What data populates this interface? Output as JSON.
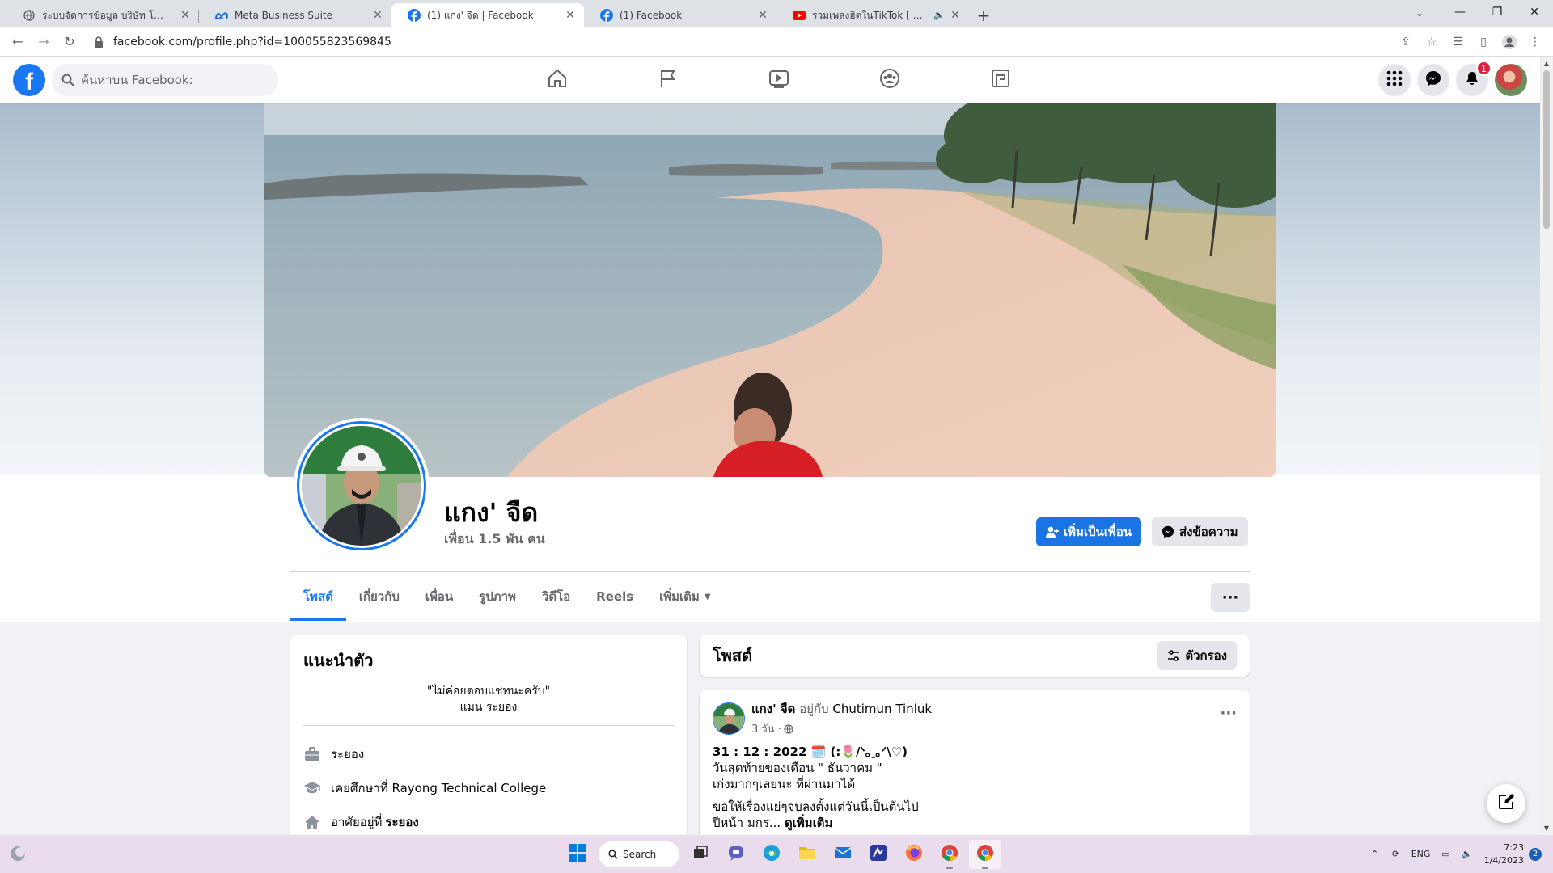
{
  "browser": {
    "tabs": [
      {
        "title": "ระบบจัดการข้อมูล บริษัท โชคลูกโชค",
        "icon": "globe-icon"
      },
      {
        "title": "Meta Business Suite",
        "icon": "meta-icon"
      },
      {
        "title": "(1) แกง' จืด | Facebook",
        "icon": "facebook-icon",
        "active": true
      },
      {
        "title": "(1) Facebook",
        "icon": "facebook-icon"
      },
      {
        "title": "รวมเพลงฮิตในTikTok [ มีเพิ่มใหม่ทุก",
        "icon": "youtube-icon"
      }
    ],
    "url": "facebook.com/profile.php?id=100055823569845"
  },
  "fb_header": {
    "logo": "f",
    "search_placeholder": "ค้นหาบน Facebook:",
    "nav": [
      "home-icon",
      "pages-flag-icon",
      "watch-video-icon",
      "groups-icon",
      "gaming-icon"
    ],
    "notifications_count": "1"
  },
  "profile": {
    "name": "แกง' จืด",
    "friends": "เพื่อน 1.5 พัน คน",
    "add_friend_label": "เพิ่มเป็นเพื่อน",
    "message_label": "ส่งข้อความ",
    "tabs": [
      "โพสต์",
      "เกี่ยวกับ",
      "เพื่อน",
      "รูปภาพ",
      "วิดีโอ",
      "Reels",
      "เพิ่มเติม"
    ],
    "more_dots": "···"
  },
  "intro": {
    "title": "แนะนำตัว",
    "bio_line1": "\"ไม่ค่อยตอบแชทนะครับ\"",
    "bio_line2": "แมน ระยอง",
    "rows": [
      {
        "icon": "work-icon",
        "text": "ระยอง",
        "bold": ""
      },
      {
        "icon": "education-icon",
        "text": "เคยศึกษาที่ Rayong Technical College",
        "bold": ""
      },
      {
        "icon": "home-location-icon",
        "text": "อาศัยอยู่ที่",
        "bold": "ระยอง"
      }
    ]
  },
  "posts": {
    "title": "โพสต์",
    "filter_label": "ตัวกรอง"
  },
  "post": {
    "author": "แกง' จืด",
    "with_text": "อยู่กับ",
    "tagged": "Chutimun Tinluk",
    "time": "3 วัน ·",
    "dots": "···",
    "line1": "31 : 12 : 2022 🗓️ (:🌷/ᐠ｡ꞈ｡ᐟ\\♡)",
    "line2": "วันสุดท้ายของเดือน \" ธันวาคม \"",
    "line3": "เก่งมากๆเลยนะ ที่ผ่านมาได้",
    "line4": "ขอให้เรื่องแย่ๆจบลงตั้งแต่วันนี้เป็นต้นไป",
    "line5": "ปีหน้า มกร...",
    "see_more": "ดูเพิ่มเติม"
  },
  "taskbar": {
    "search_label": "Search",
    "lang": "ENG",
    "time": "7:23",
    "date": "1/4/2023",
    "notif_count": "2"
  },
  "colors": {
    "fb_blue": "#1877f2",
    "button_blue": "#1b74e4",
    "badge_red": "#e41e3f"
  }
}
